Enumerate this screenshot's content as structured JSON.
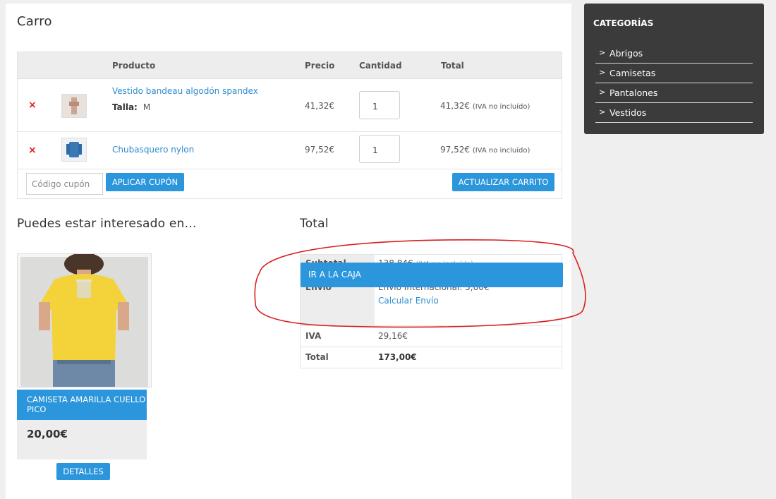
{
  "cart": {
    "title": "Carro",
    "headers": {
      "product": "Producto",
      "price": "Precio",
      "quantity": "Cantidad",
      "total": "Total"
    },
    "items": [
      {
        "name": "Vestido bandeau algodón spandex",
        "size_label": "Talla:",
        "size_value": "M",
        "price": "41,32€",
        "quantity": "1",
        "total": "41,32€",
        "total_note": "(IVA no incluído)"
      },
      {
        "name": "Chubasquero nylon",
        "price": "97,52€",
        "quantity": "1",
        "total": "97,52€",
        "total_note": "(IVA no incluído)"
      }
    ],
    "remove_symbol": "×",
    "coupon_placeholder": "Código cupón",
    "apply_coupon": "APLICAR CUPÓN",
    "update_cart": "ACTUALIZAR CARRITO"
  },
  "crosssell": {
    "title": "Puedes estar interesado en…",
    "product_name": "CAMISETA AMARILLA CUELLO PICO",
    "product_price": "20,00€",
    "details_button": "DETALLES"
  },
  "totals": {
    "title": "Total",
    "subtotal_label": "Subtotal",
    "subtotal_value": "138,84€",
    "subtotal_note": "(IVA no incluído)",
    "shipping_label": "Envío",
    "shipping_value": "Envío Internacional: 5,00€",
    "shipping_calc": "Calcular Envío",
    "tax_label": "IVA",
    "tax_value": "29,16€",
    "total_label": "Total",
    "total_value": "173,00€",
    "checkout_bar": "IR A LA CAJA"
  },
  "sidebar": {
    "title": "CATEGORÍAS",
    "chevron": ">",
    "items": [
      "Abrigos",
      "Camisetas",
      "Pantalones",
      "Vestidos"
    ]
  },
  "colors": {
    "accent": "#2b96db",
    "link": "#2d8ccf",
    "remove": "#e32020",
    "sidebar_bg": "#3b3b3b",
    "annotation": "#d81f1f"
  }
}
